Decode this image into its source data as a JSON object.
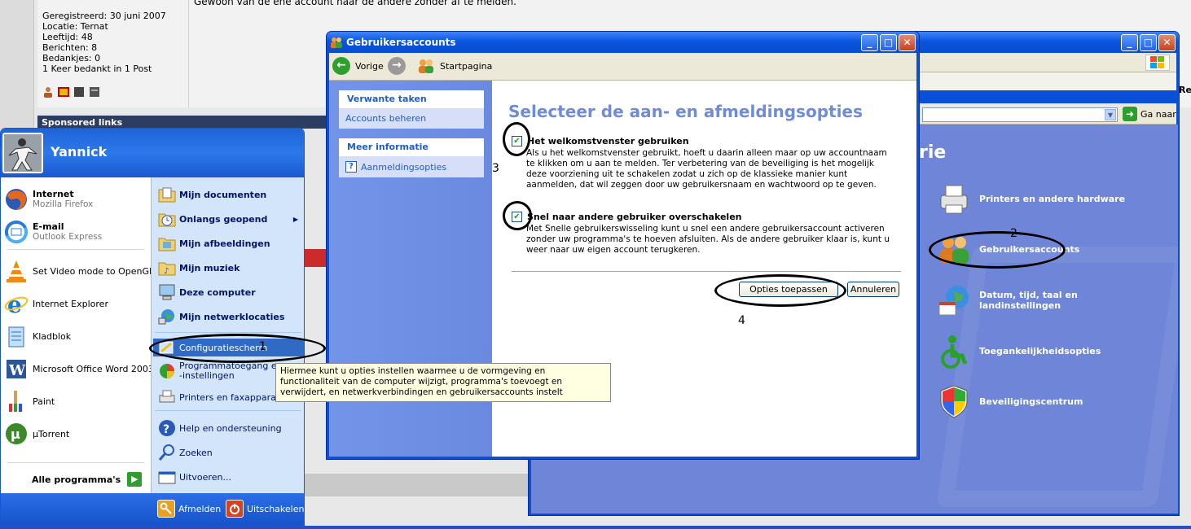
{
  "forum": {
    "post_text": "Gewoon van de ene account naar de andere zonder af te melden.",
    "profile_lines": [
      "Geregistreerd: 30 juni 2007",
      "Locatie: Ternat",
      "Leeftijd: 48",
      "Berichten: 8",
      "Bedankjes: 0",
      "1 Keer bedankt in 1 Post"
    ],
    "sponsored": "Sponsored links",
    "right_edge_text": "Re"
  },
  "control_panel": {
    "address_go": "Ga naar",
    "heading_partial": "rie",
    "items": [
      {
        "label": "Printers en andere hardware",
        "icon": "printer-icon"
      },
      {
        "label": "Gebruikersaccounts",
        "icon": "users-icon"
      },
      {
        "label": "Datum, tijd, taal en landinstellingen",
        "icon": "globe-calendar-icon"
      },
      {
        "label": "Toegankelijkheidsopties",
        "icon": "accessibility-icon"
      },
      {
        "label": "Beveiligingscentrum",
        "icon": "shield-icon"
      }
    ]
  },
  "user_accounts": {
    "title": "Gebruikersaccounts",
    "nav": {
      "back": "Vorige",
      "home": "Startpagina"
    },
    "side": {
      "related_header": "Verwante taken",
      "related_link": "Accounts beheren",
      "info_header": "Meer informatie",
      "info_link": "Aanmeldingsopties"
    },
    "heading": "Selecteer de aan- en afmeldingsopties",
    "option1": {
      "label": "Het welkomstvenster gebruiken",
      "checked": true,
      "desc": "Als u het welkomstvenster gebruikt, hoeft u daarin alleen maar op uw accountnaam te klikken om u aan te melden. Ter verbetering van de beveiliging is het mogelijk deze voorziening uit te schakelen zodat u zich op de klassieke manier kunt aanmelden, dat wil zeggen door uw gebruikersnaam en wachtwoord op te geven."
    },
    "option2": {
      "label": "Snel naar andere gebruiker overschakelen",
      "checked": true,
      "desc": "Met Snelle gebruikerswisseling kunt u snel een andere gebruikersaccount activeren zonder uw programma's te hoeven afsluiten. Als de andere gebruiker klaar is, kunt u weer naar uw eigen account terugkeren."
    },
    "apply_button": "Opties toepassen",
    "cancel_button": "Annuleren"
  },
  "start_menu": {
    "username": "Yannick",
    "left_items": [
      {
        "label": "Internet",
        "sub": "Mozilla Firefox",
        "bold": true,
        "icon": "firefox-icon"
      },
      {
        "label": "E-mail",
        "sub": "Outlook Express",
        "bold": true,
        "icon": "outlook-icon"
      },
      {
        "label": "Set Video mode to OpenGL",
        "sub": "",
        "bold": false,
        "icon": "vlc-icon"
      },
      {
        "label": "Internet Explorer",
        "sub": "",
        "bold": false,
        "icon": "ie-icon"
      },
      {
        "label": "Kladblok",
        "sub": "",
        "bold": false,
        "icon": "notepad-icon"
      },
      {
        "label": "Microsoft Office Word 2003",
        "sub": "",
        "bold": false,
        "icon": "word-icon"
      },
      {
        "label": "Paint",
        "sub": "",
        "bold": false,
        "icon": "paint-icon"
      },
      {
        "label": "µTorrent",
        "sub": "",
        "bold": false,
        "icon": "utorrent-icon"
      }
    ],
    "all_programs": "Alle programma's",
    "right_items": [
      {
        "label": "Mijn documenten",
        "icon": "folder-documents-icon"
      },
      {
        "label": "Onlangs geopend",
        "icon": "recent-icon"
      },
      {
        "label": "Mijn afbeeldingen",
        "icon": "folder-pictures-icon"
      },
      {
        "label": "Mijn muziek",
        "icon": "folder-music-icon"
      },
      {
        "label": "Deze computer",
        "icon": "computer-icon"
      },
      {
        "label": "Mijn netwerklocaties",
        "icon": "network-icon"
      }
    ],
    "control_panel": "Configuratiescherm",
    "programs_line1": "Programmatoegang en",
    "programs_line2": "-instellingen",
    "printers": "Printers en faxapparaten",
    "help": "Help en ondersteuning",
    "search": "Zoeken",
    "run": "Uitvoeren...",
    "logoff": "Afmelden",
    "shutdown": "Uitschakelen"
  },
  "tooltip": "Hiermee kunt u opties instellen waarmee u de vormgeving en functionaliteit van de computer wijzigt, programma's toevoegt en verwijdert, en netwerkverbindingen en gebruikersaccounts instelt",
  "annotations": [
    "1",
    "2",
    "3",
    "4"
  ],
  "colors": {
    "xp_blue": "#0a4fd8",
    "selection_blue": "#316ac5",
    "heading_blue": "#6e8cd7",
    "tooltip_bg": "#ffffe1"
  }
}
